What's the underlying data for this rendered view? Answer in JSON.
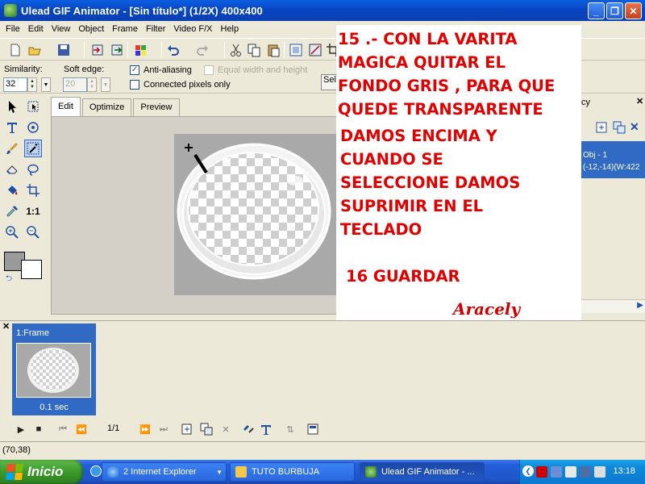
{
  "window": {
    "title": "Ulead GIF Animator - [Sin título*] (1/2X)  400x400",
    "controls": {
      "minimize": "_",
      "maximize": "❐",
      "close": "✕"
    }
  },
  "menu": [
    "File",
    "Edit",
    "View",
    "Object",
    "Frame",
    "Filter",
    "Video F/X",
    "Help"
  ],
  "options": {
    "similarity_label": "Similarity:",
    "similarity_value": "32",
    "soft_edge_label": "Soft edge:",
    "soft_edge_value": "20",
    "anti_aliasing_label": "Anti-aliasing",
    "anti_aliasing_checked": "✓",
    "connected_pixels_label": "Connected pixels only",
    "equal_width_label": "Equal width and height",
    "select_button": "Sel"
  },
  "editor": {
    "tabs": [
      "Edit",
      "Optimize",
      "Preview"
    ]
  },
  "right_panel": {
    "header_fragment": "cy",
    "object_line1": "Obj - 1",
    "object_line2": "(-12,-14)(W:422"
  },
  "tutorial": {
    "step15": [
      "15 .- CON LA VARITA",
      "MAGICA QUITAR EL",
      "FONDO GRIS , PARA QUE",
      "QUEDE TRANSPARENTE"
    ],
    "step15b": [
      "DAMOS ENCIMA Y",
      "CUANDO SE",
      "SELECCIONE DAMOS",
      "SUPRIMIR EN EL",
      "TECLADO"
    ],
    "step16": "16 GUARDAR",
    "signature": "Aracely"
  },
  "frames": {
    "items": [
      {
        "label": "1:Frame",
        "delay": "0.1 sec"
      }
    ],
    "counter": "1/1"
  },
  "status": {
    "coords": "(70,38)"
  },
  "taskbar": {
    "start": "Inicio",
    "items": [
      "2 Internet Explorer",
      "TUTO BURBUJA",
      "Ulead GIF Animator - ..."
    ],
    "clock": "13:18"
  },
  "colors": {
    "accent": "#316ac5",
    "tutorial_text": "#e00000",
    "canvas_grey": "#a9a9a9"
  }
}
